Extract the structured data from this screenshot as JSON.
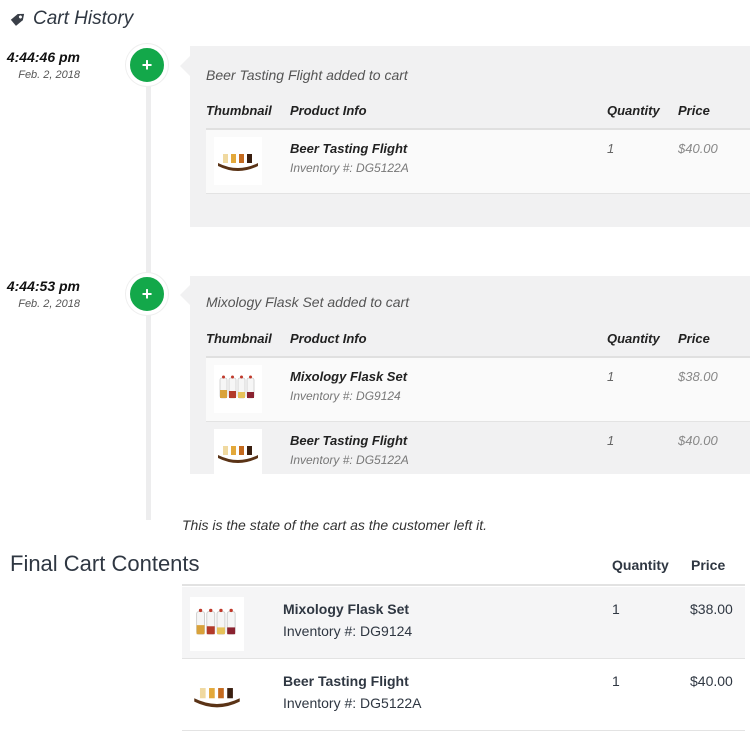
{
  "header": {
    "title": "Cart History",
    "icon": "tag-icon"
  },
  "events": [
    {
      "time": "4:44:46 pm",
      "date": "Feb. 2, 2018",
      "title": "Beer Tasting Flight added to cart",
      "columns": {
        "thumbnail": "Thumbnail",
        "info": "Product Info",
        "quantity": "Quantity",
        "price": "Price"
      },
      "items": [
        {
          "name": "Beer Tasting Flight",
          "inventory": "Inventory #: DG5122A",
          "quantity": "1",
          "price": "$40.00"
        }
      ]
    },
    {
      "time": "4:44:53 pm",
      "date": "Feb. 2, 2018",
      "title": "Mixology Flask Set added to cart",
      "columns": {
        "thumbnail": "Thumbnail",
        "info": "Product Info",
        "quantity": "Quantity",
        "price": "Price"
      },
      "items": [
        {
          "name": "Mixology Flask Set",
          "inventory": "Inventory #: DG9124",
          "quantity": "1",
          "price": "$38.00"
        },
        {
          "name": "Beer Tasting Flight",
          "inventory": "Inventory #: DG5122A",
          "quantity": "1",
          "price": "$40.00"
        }
      ]
    }
  ],
  "note": "This is the state of the cart as the customer left it.",
  "final_cart": {
    "title": "Final Cart Contents",
    "columns": {
      "quantity": "Quantity",
      "price": "Price"
    },
    "items": [
      {
        "name": "Mixology Flask Set",
        "inventory": "Inventory #: DG9124",
        "quantity": "1",
        "price": "$38.00"
      },
      {
        "name": "Beer Tasting Flight",
        "inventory": "Inventory #: DG5122A",
        "quantity": "1",
        "price": "$40.00"
      }
    ]
  },
  "colors": {
    "accent_green": "#13a84a",
    "card_bg": "#f1f1f2",
    "text": "#2f3742"
  }
}
